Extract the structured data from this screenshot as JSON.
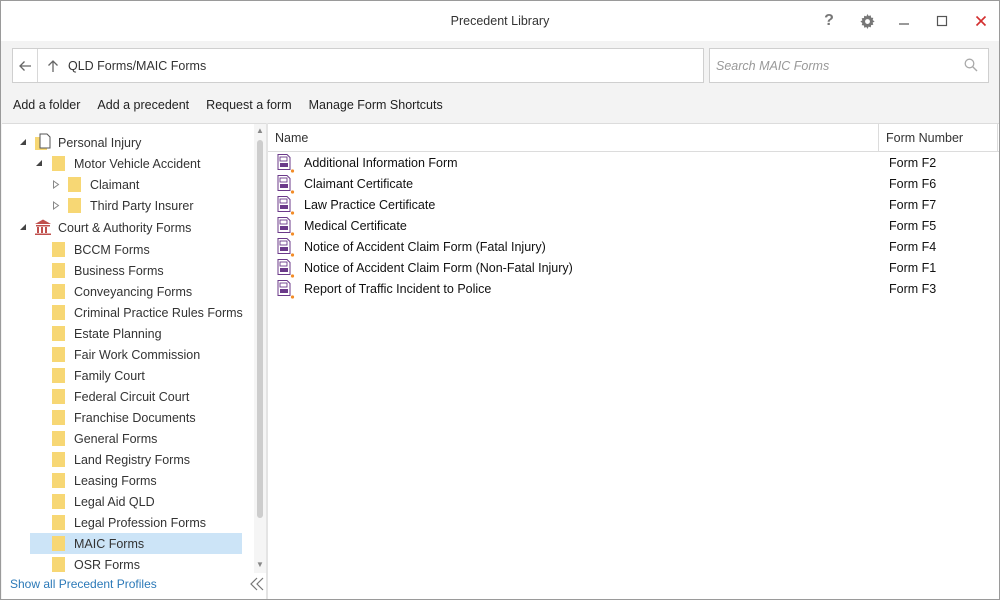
{
  "window": {
    "title": "Precedent Library"
  },
  "titlebar": {
    "help_glyph": "?"
  },
  "address": {
    "path": "QLD Forms/MAIC Forms"
  },
  "search": {
    "placeholder": "Search MAIC Forms",
    "value": ""
  },
  "toolbar": {
    "add_folder": "Add a folder",
    "add_precedent": "Add a precedent",
    "request_form": "Request a form",
    "manage_shortcuts": "Manage Form Shortcuts"
  },
  "tree": {
    "personal_injury": "Personal Injury",
    "motor_vehicle_accident": "Motor Vehicle Accident",
    "claimant": "Claimant",
    "third_party_insurer": "Third Party Insurer",
    "court_authority_forms": "Court & Authority Forms",
    "folders": [
      "BCCM Forms",
      "Business Forms",
      "Conveyancing Forms",
      "Criminal Practice Rules Forms",
      "Estate Planning",
      "Fair Work Commission",
      "Family Court",
      "Federal Circuit Court",
      "Franchise Documents",
      "General Forms",
      "Land Registry Forms",
      "Leasing Forms",
      "Legal Aid QLD",
      "Legal Profession Forms",
      "MAIC Forms",
      "OSR Forms"
    ],
    "selected": "MAIC Forms"
  },
  "footer": {
    "show_all": "Show all Precedent Profiles"
  },
  "list": {
    "columns": {
      "name": "Name",
      "number": "Form Number"
    },
    "rows": [
      {
        "name": "Additional Information Form",
        "number": "Form F2"
      },
      {
        "name": "Claimant Certificate",
        "number": "Form F6"
      },
      {
        "name": "Law Practice Certificate",
        "number": "Form F7"
      },
      {
        "name": "Medical Certificate",
        "number": "Form F5"
      },
      {
        "name": "Notice of Accident Claim Form (Fatal Injury)",
        "number": "Form F4"
      },
      {
        "name": "Notice of Accident Claim Form (Non-Fatal Injury)",
        "number": "Form F1"
      },
      {
        "name": "Report of Traffic Incident to Police",
        "number": "Form F3"
      }
    ]
  },
  "colors": {
    "folder": "#f7d774",
    "selection": "#cce4f7",
    "link": "#2b79b8",
    "close": "#d32f2f",
    "form_icon": "#6b3a8a",
    "court_icon": "#c0504d"
  }
}
